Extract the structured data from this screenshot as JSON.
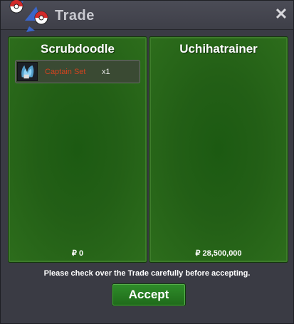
{
  "window": {
    "title": "Trade",
    "close_symbol": "✕"
  },
  "left_panel": {
    "trader_name": "Scrubdoodle",
    "items": [
      {
        "name": "Captain Set",
        "quantity": "x1"
      }
    ],
    "money": "₽ 0"
  },
  "right_panel": {
    "trader_name": "Uchihatrainer",
    "items": [],
    "money": "₽ 28,500,000"
  },
  "footer": {
    "notice": "Please check over the Trade carefully before accepting.",
    "accept_label": "Accept"
  },
  "colors": {
    "panel_green": "#235f16",
    "item_name": "#d2431f",
    "accent_button": "#2f8d2a"
  },
  "icons": {
    "logo": "pokeball-logo-icon",
    "close": "close-icon",
    "item": "captain-set-icon"
  }
}
